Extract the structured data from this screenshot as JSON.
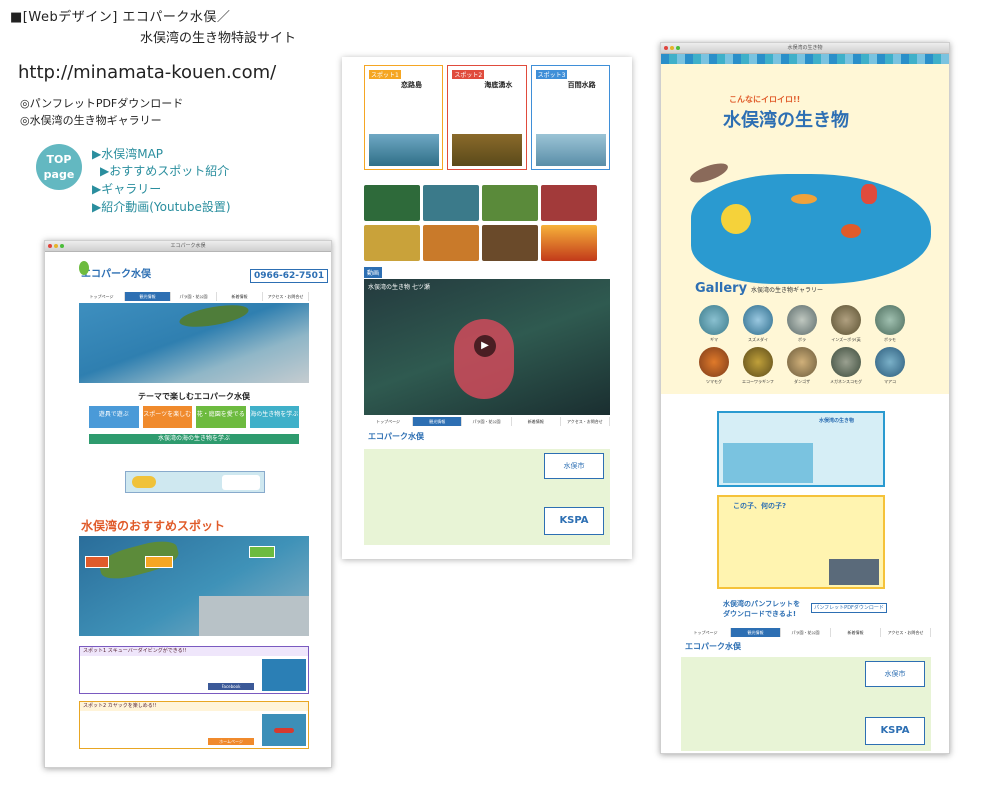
{
  "header": {
    "title_line1": "■[Webデザイン] エコパーク水俣／",
    "title_line2": "水俣湾の生き物特設サイト",
    "url": "http://minamata-kouen.com/",
    "downloads": [
      "◎パンフレットPDFダウンロード",
      "◎水俣湾の生き物ギャラリー"
    ]
  },
  "top_badge": {
    "line1": "TOP",
    "line2": "page"
  },
  "top_nav": [
    "▶水俣湾MAP",
    "▶おすすめスポット紹介",
    "▶ギャラリー",
    "▶紹介動画(Youtube設置)"
  ],
  "site1": {
    "logo": "エコパーク水俣",
    "phone": "0966-62-7501",
    "nav": [
      "トップページ",
      "観光情報",
      "パラ園・花公園",
      "新着情報",
      "アクセス・お問合せ"
    ],
    "theme_title": "テーマで楽しむエコパーク水俣",
    "themes": [
      {
        "label": "遊具で遊ぶ",
        "color": "#4a9ad8"
      },
      {
        "label": "スポーツを楽しむ",
        "color": "#f08a2c"
      },
      {
        "label": "花・庭園を愛でる",
        "color": "#6dbb3f"
      },
      {
        "label": "海の生き物を学ぶ",
        "color": "#3fb0c9"
      }
    ],
    "sea_banner": "水俣湾の海の生き物を学ぶ",
    "special_title": "水俣湾のおすすめスポット",
    "spot1_title": "スポット1 スキューバーダイビングができる!!",
    "spot2_title": "スポット2 カヤックを楽しめる!!",
    "fb_button": "Facebook",
    "more_button": "ホームページ"
  },
  "site2": {
    "spots": [
      {
        "tag": "スポット1",
        "name": "恋路島",
        "color": "#f5a623"
      },
      {
        "tag": "スポット2",
        "name": "海底湧水",
        "color": "#e04b3c"
      },
      {
        "tag": "スポット3",
        "name": "百間水路",
        "color": "#3f8fd8"
      }
    ],
    "video_label": "動画",
    "video_title": "水俣湾の生き物 七ツ瀬",
    "nav": [
      "トップページ",
      "観光情報",
      "パラ園・花公園",
      "新着情報",
      "アクセス・お問合せ"
    ],
    "logo": "エコパーク水俣",
    "city": "水俣市",
    "kspa": "KSPA"
  },
  "site3": {
    "hero_sub": "こんなにイロイロ!!",
    "hero_title": "水俣湾の生き物",
    "gallery_title": "Gallery",
    "gallery_sub": "水俣湾の生き物ギャラリー",
    "gallery_row1": [
      "ギマ",
      "スズメダイ",
      "ボラ",
      "インズーボラ(英",
      "ボラモ"
    ],
    "gallery_row2": [
      "ツマモグ",
      "エコーワラギンフ",
      "ダンゴザ",
      "メガネンスコモグ",
      "マアコ"
    ],
    "info_title": "水俣湾の生き物",
    "quiz_title": "この子、何の子?",
    "download_text": "水俣湾のパンフレットをダウンロードできるよ!",
    "download_button": "パンフレットPDFダウンロード",
    "nav": [
      "トップページ",
      "観光情報",
      "パラ園・花公園",
      "新着情報",
      "アクセス・お問合せ"
    ],
    "logo": "エコパーク水俣",
    "city": "水俣市",
    "kspa": "KSPA"
  },
  "colors": {
    "accent": "#2d6fb3",
    "teal": "#63b8c1",
    "green_footer": "#e8f4d6"
  }
}
